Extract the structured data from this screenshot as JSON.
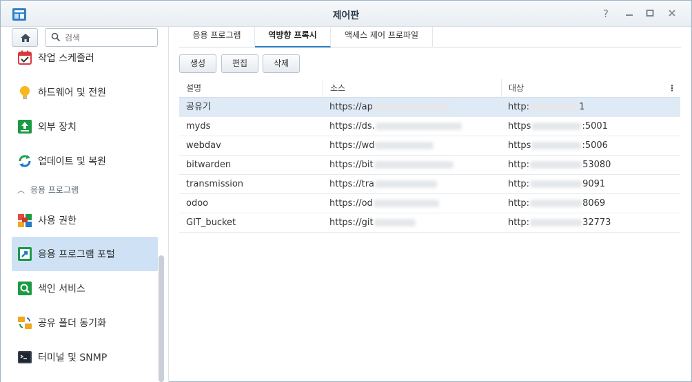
{
  "window": {
    "title": "제어판",
    "help_icon": "help-icon",
    "minimize_icon": "minimize-icon",
    "maximize_icon": "maximize-icon",
    "close_icon": "close-icon"
  },
  "sidebar": {
    "search_placeholder": "검색",
    "group_label": "응용 프로그램",
    "items": [
      {
        "label": "작업 스케줄러",
        "icon": "task-scheduler-icon"
      },
      {
        "label": "하드웨어 및 전원",
        "icon": "lightbulb-icon"
      },
      {
        "label": "외부 장치",
        "icon": "external-device-icon"
      },
      {
        "label": "업데이트 및 복원",
        "icon": "update-restore-icon"
      },
      {
        "label": "사용 권한",
        "icon": "privileges-icon"
      },
      {
        "label": "응용 프로그램 포털",
        "icon": "application-portal-icon"
      },
      {
        "label": "색인 서비스",
        "icon": "indexing-service-icon"
      },
      {
        "label": "공유 폴더 동기화",
        "icon": "shared-folder-sync-icon"
      },
      {
        "label": "터미널 및 SNMP",
        "icon": "terminal-icon"
      }
    ]
  },
  "tabs": [
    {
      "label": "응용 프로그램"
    },
    {
      "label": "역방향 프록시"
    },
    {
      "label": "액세스 제어 프로파일"
    }
  ],
  "toolbar": {
    "create_label": "생성",
    "edit_label": "편집",
    "delete_label": "삭제"
  },
  "table": {
    "columns": [
      "설명",
      "소스",
      "대상"
    ],
    "menu_icon": "column-menu-icon",
    "rows": [
      {
        "desc": "공유기",
        "source": "https://ap",
        "target_pre": "http:",
        "target_post": "1"
      },
      {
        "desc": "myds",
        "source": "https://ds.",
        "target_pre": "https",
        "target_post": ":5001"
      },
      {
        "desc": "webdav",
        "source": "https://wd",
        "target_pre": "https",
        "target_post": ":5006"
      },
      {
        "desc": "bitwarden",
        "source": "https://bit",
        "target_pre": "http:",
        "target_post": "53080"
      },
      {
        "desc": "transmission",
        "source": "https://tra",
        "target_pre": "http:",
        "target_post": "9091"
      },
      {
        "desc": "odoo",
        "source": "https://od",
        "target_pre": "http:",
        "target_post": "8069"
      },
      {
        "desc": "GIT_bucket",
        "source": "https://git",
        "target_pre": "http:",
        "target_post": "32773"
      }
    ]
  },
  "colors": {
    "selected_row": "#dfeaf7",
    "active_sidebar": "#cfe2f5",
    "accent": "#2a7ac2"
  }
}
